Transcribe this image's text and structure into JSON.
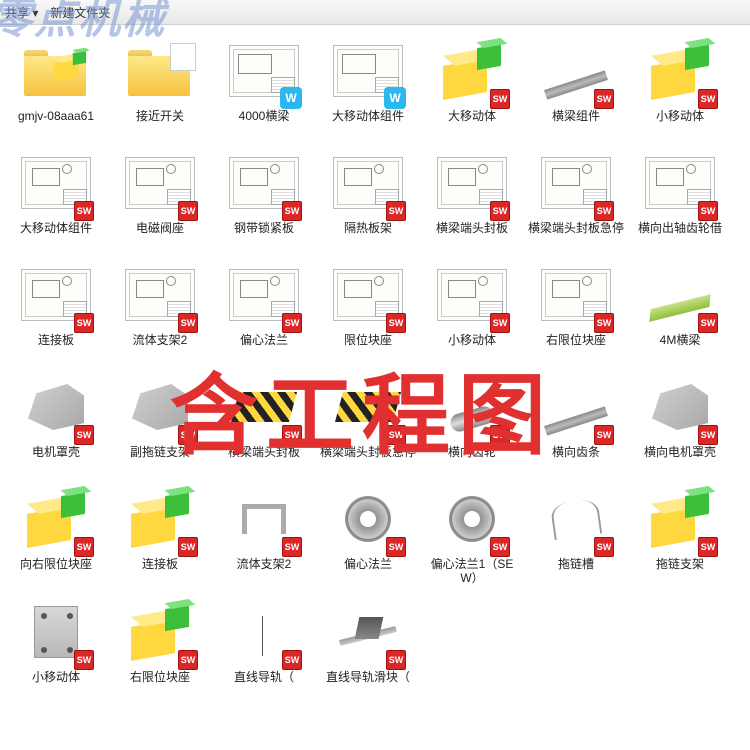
{
  "watermark": "零点机械",
  "overlay": "含工程图",
  "toolbar": {
    "share": "共享 ▾",
    "newfolder": "新建文件夹"
  },
  "items": [
    {
      "label": "gmjv-08aaa61",
      "type": "folder-asm"
    },
    {
      "label": "接近开关",
      "type": "folder-doc"
    },
    {
      "label": "4000横梁",
      "type": "dwg-w"
    },
    {
      "label": "大移动体组件",
      "type": "dwg-w"
    },
    {
      "label": "大移动体",
      "type": "asm"
    },
    {
      "label": "横梁组件",
      "type": "bar-sw"
    },
    {
      "label": "小移动体",
      "type": "asm"
    },
    {
      "label": "大移动体组件",
      "type": "dwg-sw"
    },
    {
      "label": "电磁阀座",
      "type": "dwg-sw"
    },
    {
      "label": "钢带锁紧板",
      "type": "dwg-sw"
    },
    {
      "label": "隔热板架",
      "type": "dwg-sw"
    },
    {
      "label": "横梁端头封板",
      "type": "dwg-sw"
    },
    {
      "label": "横梁端头封板急停",
      "type": "dwg-sw"
    },
    {
      "label": "横向出轴齿轮借",
      "type": "dwg-sw"
    },
    {
      "label": "连接板",
      "type": "dwg-sw"
    },
    {
      "label": "流体支架2",
      "type": "dwg-sw"
    },
    {
      "label": "偏心法兰",
      "type": "dwg-sw"
    },
    {
      "label": "限位块座",
      "type": "dwg-sw"
    },
    {
      "label": "小移动体",
      "type": "dwg-sw"
    },
    {
      "label": "右限位块座",
      "type": "dwg-sw"
    },
    {
      "label": "4M横梁",
      "type": "beam-sw"
    },
    {
      "label": "电机罩壳",
      "type": "part-sw"
    },
    {
      "label": "副拖链支架",
      "type": "part-sw"
    },
    {
      "label": "横梁端头封板",
      "type": "stripe-sw"
    },
    {
      "label": "横梁端头封板急停",
      "type": "stripe-sw"
    },
    {
      "label": "横向齿轮",
      "type": "cyl-sw"
    },
    {
      "label": "横向齿条",
      "type": "bar-sw"
    },
    {
      "label": "横向电机罩壳",
      "type": "part-sw"
    },
    {
      "label": "向右限位块座",
      "type": "asm"
    },
    {
      "label": "连接板",
      "type": "asm"
    },
    {
      "label": "流体支架2",
      "type": "cframe-sw"
    },
    {
      "label": "偏心法兰",
      "type": "ring-sw"
    },
    {
      "label": "偏心法兰1（SEW）",
      "type": "ring-sw"
    },
    {
      "label": "拖链槽",
      "type": "wire-sw"
    },
    {
      "label": "拖链支架",
      "type": "asm"
    },
    {
      "label": "小移动体",
      "type": "plate-sw"
    },
    {
      "label": "右限位块座",
      "type": "asm"
    },
    {
      "label": "直线导轨（",
      "type": "thin-sw"
    },
    {
      "label": "直线导轨滑块（",
      "type": "linear-sw"
    }
  ]
}
